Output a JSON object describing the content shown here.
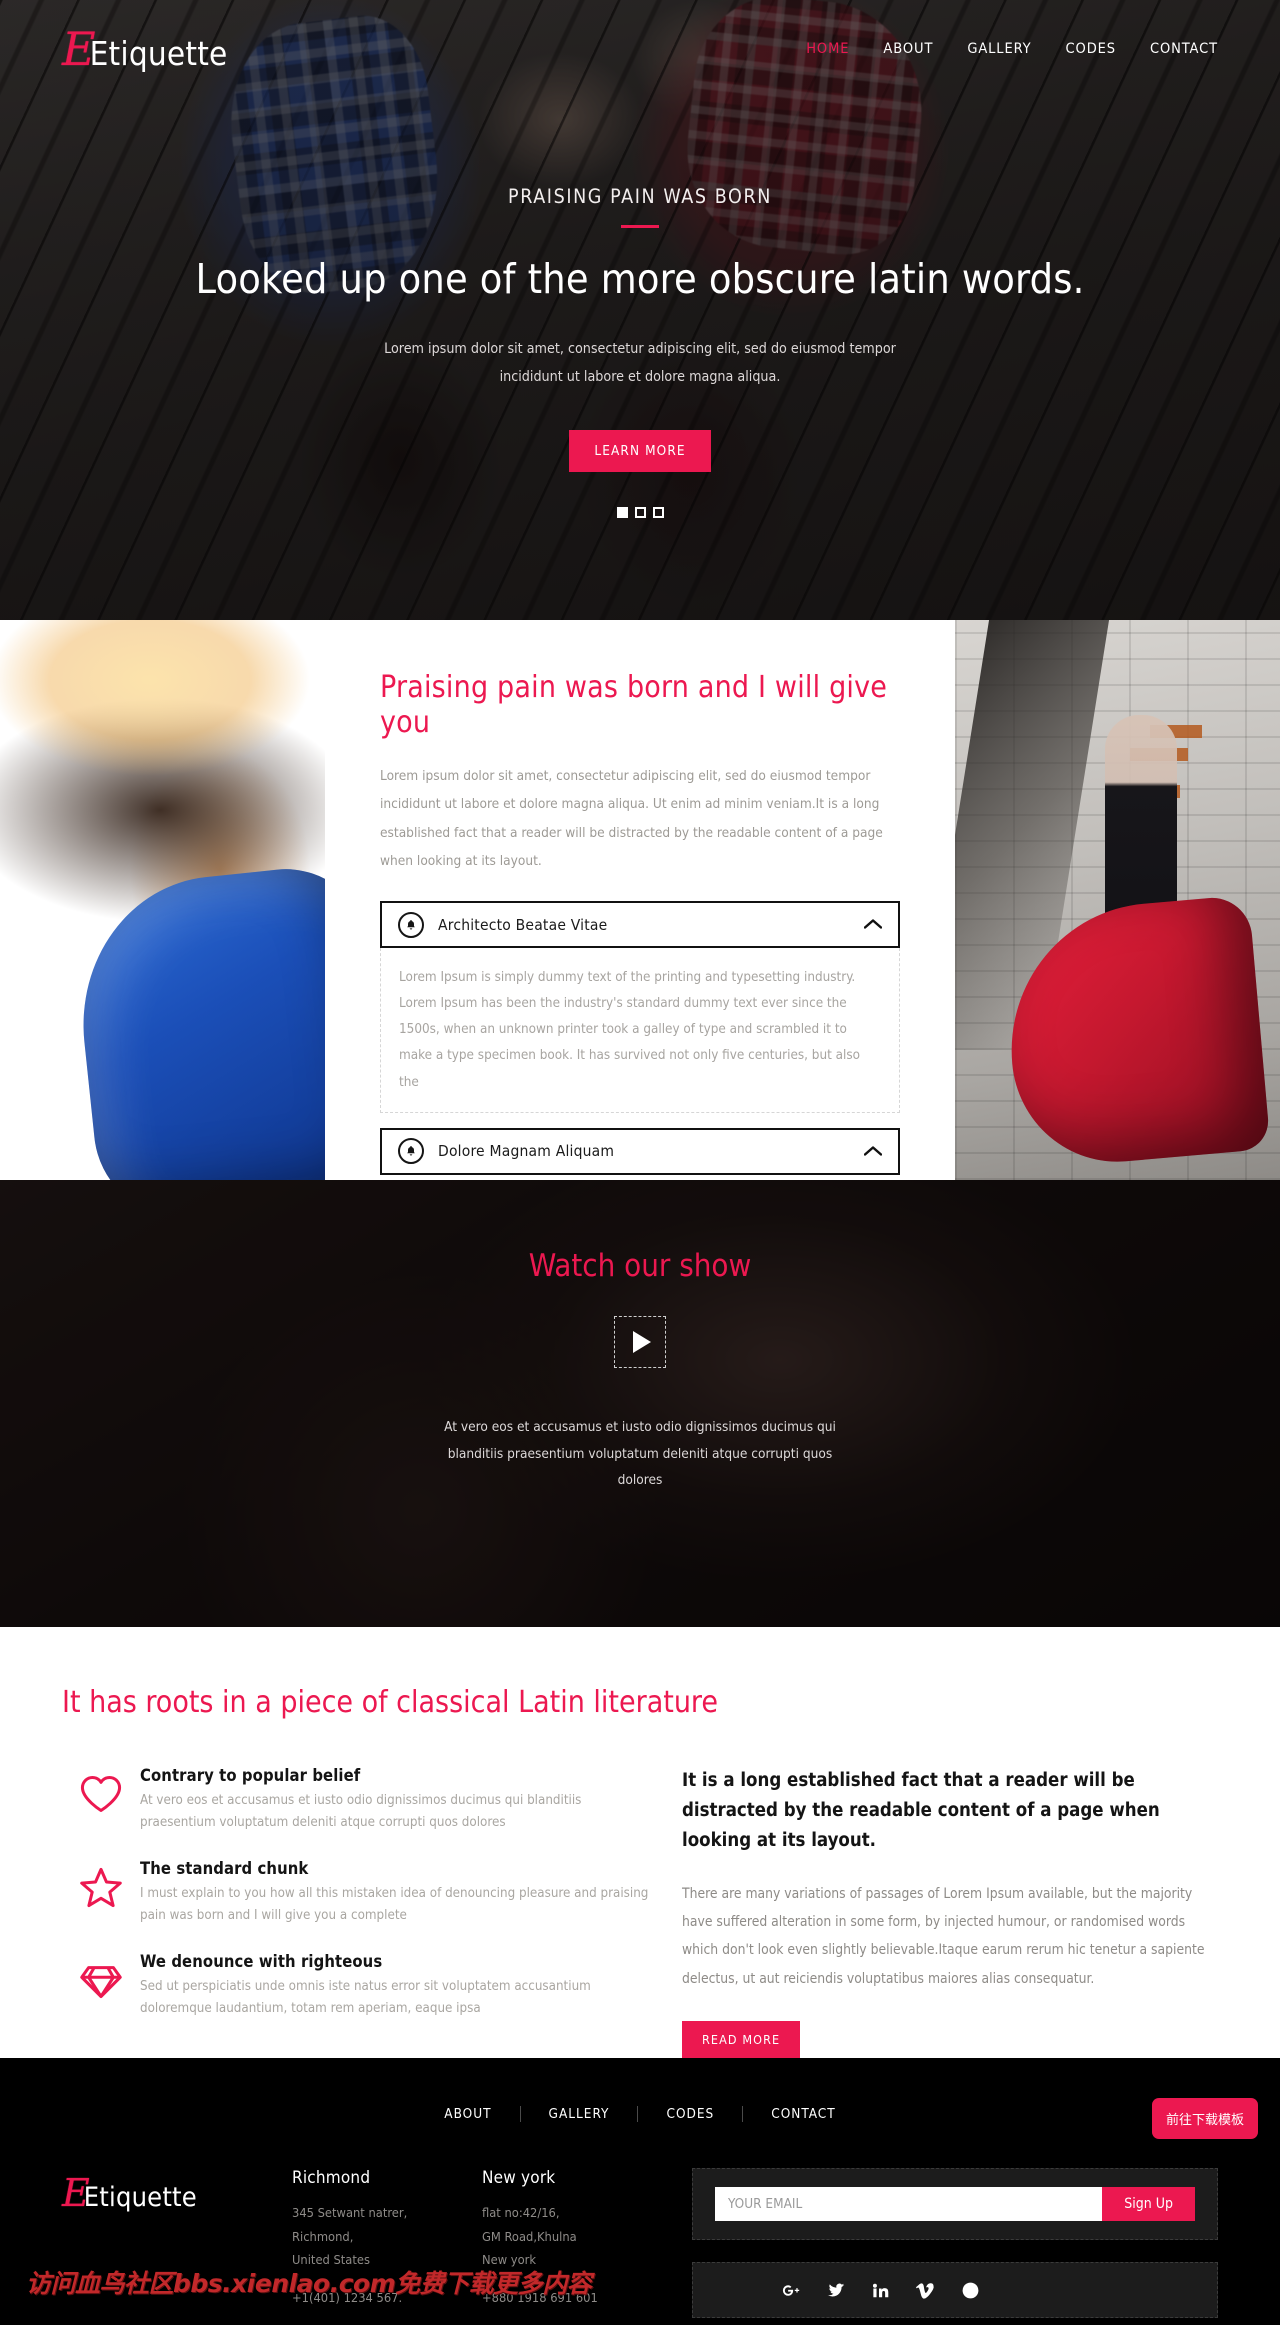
{
  "brand": {
    "mark": "E",
    "word": "Etiquette"
  },
  "colors": {
    "accent": "#ec1850",
    "dark": "#000000",
    "body_text": "#9d9a95"
  },
  "nav": {
    "items": [
      {
        "label": "HOME",
        "active": true
      },
      {
        "label": "ABOUT",
        "active": false
      },
      {
        "label": "GALLERY",
        "active": false
      },
      {
        "label": "CODES",
        "active": false
      },
      {
        "label": "CONTACT",
        "active": false
      }
    ]
  },
  "hero": {
    "eyebrow": "PRAISING PAIN WAS BORN",
    "title": "Looked up one of the more obscure latin words.",
    "subtitle": "Lorem ipsum dolor sit amet, consectetur adipiscing elit, sed do eiusmod tempor incididunt ut labore et dolore magna aliqua.",
    "cta_label": "LEARN MORE",
    "slides": 3,
    "active_slide": 1
  },
  "about": {
    "heading": "Praising pain was born and I will give you",
    "paragraph": "Lorem ipsum dolor sit amet, consectetur adipiscing elit, sed do eiusmod tempor incididunt ut labore et dolore magna aliqua. Ut enim ad minim veniam.It is a long established fact that a reader will be distracted by the readable content of a page when looking at its layout.",
    "accordion": [
      {
        "title": "Architecto Beatae Vitae",
        "icon": "bell-icon",
        "expanded": true,
        "body": "Lorem Ipsum is simply dummy text of the printing and typesetting industry. Lorem Ipsum has been the industry's standard dummy text ever since the 1500s, when an unknown printer took a galley of type and scrambled it to make a type specimen book. It has survived not only five centuries, but also the"
      },
      {
        "title": "Dolore Magnam Aliquam",
        "icon": "bell-icon",
        "expanded": false,
        "body": ""
      }
    ]
  },
  "video": {
    "heading": "Watch our show",
    "play_label": "play-button",
    "caption": "At vero eos et accusamus et iusto odio dignissimos ducimus qui blanditiis praesentium voluptatum deleniti atque corrupti quos dolores"
  },
  "features": {
    "heading": "It has roots in a piece of classical Latin literature",
    "items": [
      {
        "icon": "heart-icon",
        "title": "Contrary to popular belief",
        "text": "At vero eos et accusamus et iusto odio dignissimos ducimus qui blanditiis praesentium voluptatum deleniti atque corrupti quos dolores"
      },
      {
        "icon": "star-icon",
        "title": "The standard chunk",
        "text": "I must explain to you how all this mistaken idea of denouncing pleasure and praising pain was born and I will give you a complete"
      },
      {
        "icon": "diamond-icon",
        "title": "We denounce with righteous",
        "text": "Sed ut perspiciatis unde omnis iste natus error sit voluptatem accusantium doloremque laudantium, totam rem aperiam, eaque ipsa"
      }
    ],
    "right": {
      "heading": "It is a long established fact that a reader will be distracted by the readable content of a page when looking at its layout.",
      "paragraph": "There are many variations of passages of Lorem Ipsum available, but the majority have suffered alteration in some form, by injected humour, or randomised words which don't look even slightly believable.Itaque earum rerum hic tenetur a sapiente delectus, ut aut reiciendis voluptatibus maiores alias consequatur.",
      "cta_label": "READ MORE"
    }
  },
  "footer": {
    "nav": [
      {
        "label": "ABOUT"
      },
      {
        "label": "GALLERY"
      },
      {
        "label": "CODES"
      },
      {
        "label": "CONTACT"
      }
    ],
    "offices": [
      {
        "city": "Richmond",
        "address": "345 Setwant natrer,\nRichmond,\nUnited States",
        "phone": "+1(401) 1234 567."
      },
      {
        "city": "New york",
        "address": "flat no:42/16,\nGM Road,Khulna\nNew york",
        "phone": "+880 1918 691 601"
      }
    ],
    "signup": {
      "placeholder": "YOUR EMAIL",
      "value": "",
      "button_label": "Sign Up"
    },
    "social": [
      {
        "name": "google-plus-icon"
      },
      {
        "name": "twitter-icon"
      },
      {
        "name": "linkedin-icon"
      },
      {
        "name": "vimeo-icon"
      },
      {
        "name": "dribbble-icon"
      }
    ]
  },
  "overlay": {
    "download_button": "前往下载模板",
    "watermark": "访问血鸟社区bbs.xienlao.com免费下载更多内容"
  }
}
